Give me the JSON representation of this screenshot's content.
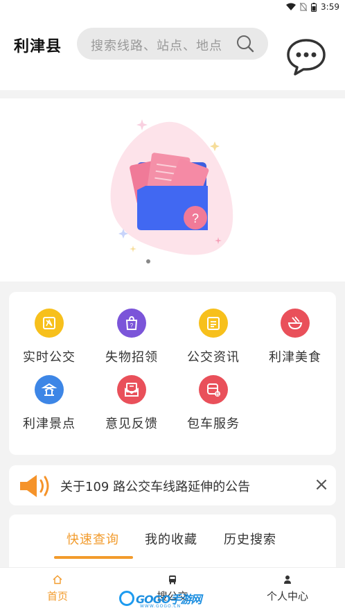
{
  "status_bar": {
    "time": "3:59"
  },
  "header": {
    "location": "利津县",
    "search_placeholder": "搜索线路、站点、地点"
  },
  "services": [
    {
      "label": "实时公交",
      "icon": "bus-realtime-icon",
      "color": "#f7c01c"
    },
    {
      "label": "失物招领",
      "icon": "lost-found-icon",
      "color": "#7b55d9"
    },
    {
      "label": "公交资讯",
      "icon": "news-icon",
      "color": "#f7c01c"
    },
    {
      "label": "利津美食",
      "icon": "food-icon",
      "color": "#e9505a"
    },
    {
      "label": "利津景点",
      "icon": "scenic-icon",
      "color": "#3d86e6"
    },
    {
      "label": "意见反馈",
      "icon": "feedback-icon",
      "color": "#e9505a"
    },
    {
      "label": "包车服务",
      "icon": "charter-icon",
      "color": "#e9505a"
    }
  ],
  "notice": {
    "text": "关于109 路公交车线路延伸的公告"
  },
  "tabs": [
    {
      "label": "快速查询",
      "active": true
    },
    {
      "label": "我的收藏",
      "active": false
    },
    {
      "label": "历史搜索",
      "active": false
    }
  ],
  "bottom_nav": [
    {
      "label": "首页",
      "icon": "home-icon",
      "active": true
    },
    {
      "label": "搜公交",
      "icon": "bus-icon",
      "active": false
    },
    {
      "label": "个人中心",
      "icon": "person-icon",
      "active": false
    }
  ],
  "watermark": {
    "text": "GOGO手游网",
    "sub": "WWW.GOGO.CN"
  },
  "colors": {
    "accent": "#f29b2c",
    "background": "#f3f3f3"
  }
}
